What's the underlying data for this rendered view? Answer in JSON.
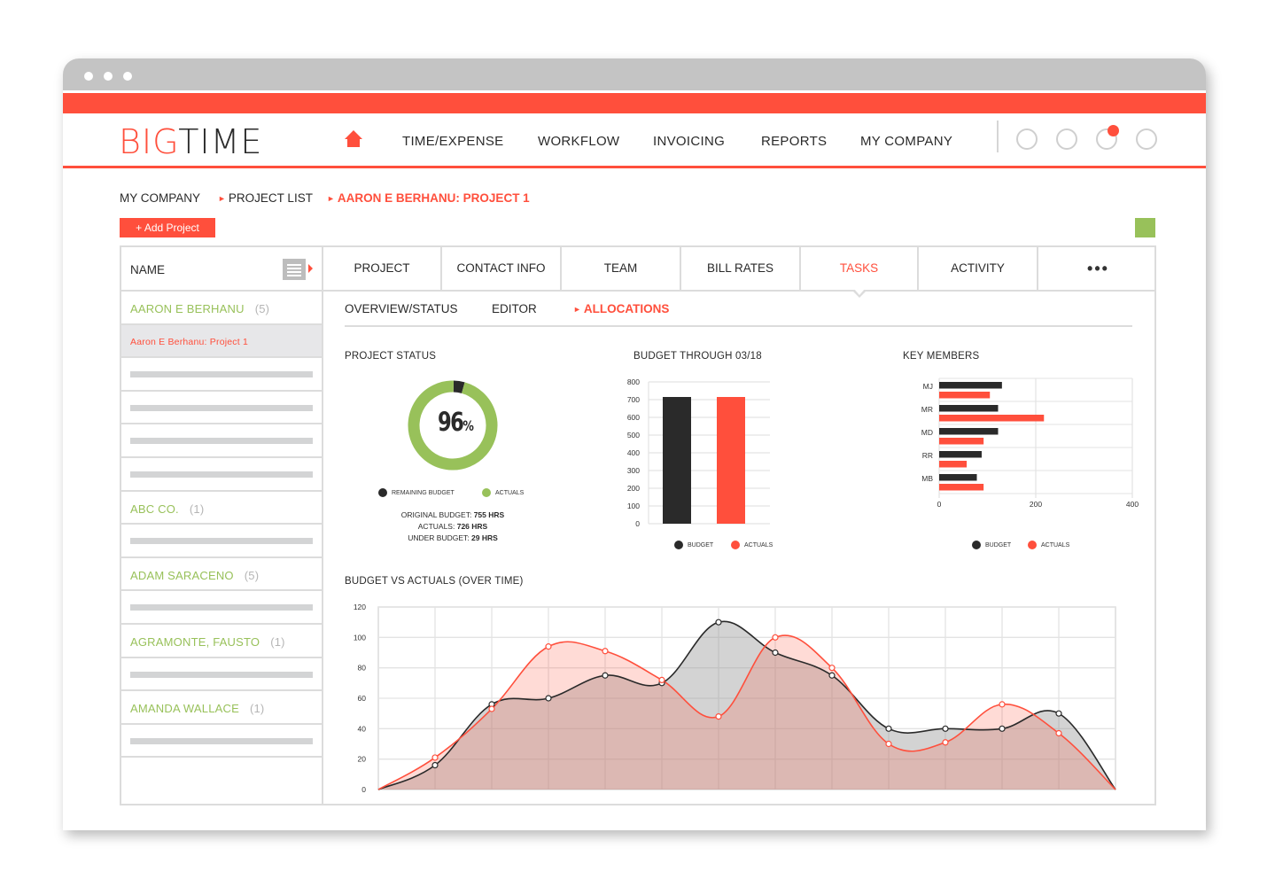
{
  "window": {
    "controls": [
      "close",
      "minimize",
      "maximize"
    ]
  },
  "header": {
    "logo_part1": "BIG",
    "logo_part2": "TIME",
    "home_icon": "home-icon",
    "nav": [
      "TIME/EXPENSE",
      "WORKFLOW",
      "INVOICING",
      "REPORTS",
      "MY COMPANY"
    ],
    "action_icons": [
      "action-icon-1",
      "action-icon-2",
      "notifications-icon",
      "action-icon-4"
    ],
    "notification_badge": true
  },
  "breadcrumb": [
    "MY COMPANY",
    "PROJECT LIST",
    "AARON E BERHANU: PROJECT 1"
  ],
  "add_project_label": "+ Add Project",
  "left_list": {
    "header": "NAME",
    "rows": [
      {
        "type": "group",
        "name": "AARON E BERHANU",
        "count": "(5)"
      },
      {
        "type": "selected",
        "name": "Aaron E Berhanu: Project 1"
      },
      {
        "type": "placeholder"
      },
      {
        "type": "placeholder"
      },
      {
        "type": "placeholder"
      },
      {
        "type": "placeholder"
      },
      {
        "type": "group",
        "name": "ABC CO.",
        "count": "(1)"
      },
      {
        "type": "placeholder"
      },
      {
        "type": "group",
        "name": "ADAM SARACENO",
        "count": "(5)"
      },
      {
        "type": "placeholder"
      },
      {
        "type": "group",
        "name": "AGRAMONTE, FAUSTO",
        "count": "(1)"
      },
      {
        "type": "placeholder"
      },
      {
        "type": "group",
        "name": "AMANDA WALLACE",
        "count": "(1)"
      },
      {
        "type": "placeholder"
      }
    ]
  },
  "tabs": [
    "PROJECT",
    "CONTACT INFO",
    "TEAM",
    "BILL RATES",
    "TASKS",
    "ACTIVITY",
    "•••"
  ],
  "active_tab": "TASKS",
  "subtabs": [
    "OVERVIEW/STATUS",
    "EDITOR",
    "ALLOCATIONS"
  ],
  "active_subtab": "ALLOCATIONS",
  "colors": {
    "accent": "#ff4f3c",
    "green": "#98c15a",
    "dark": "#2a2a2a",
    "grid": "#e3e3e3"
  },
  "project_status": {
    "title": "PROJECT STATUS",
    "percent_label": "96",
    "percent_sign": "%",
    "legend": [
      "REMAINING BUDGET",
      "ACTUALS"
    ],
    "stats": [
      {
        "label": "ORIGINAL BUDGET:",
        "value": "755 HRS"
      },
      {
        "label": "ACTUALS:",
        "value": "726 HRS"
      },
      {
        "label": "UNDER BUDGET:",
        "value": "29 HRS"
      }
    ]
  },
  "budget_through": {
    "title": "BUDGET THROUGH 03/18",
    "legend": [
      "BUDGET",
      "ACTUALS"
    ]
  },
  "key_members": {
    "title": "KEY MEMBERS",
    "legend": [
      "BUDGET",
      "ACTUALS"
    ]
  },
  "budget_vs_actuals": {
    "title": "BUDGET VS ACTUALS (OVER TIME)"
  },
  "chart_data": [
    {
      "type": "pie",
      "title": "PROJECT STATUS",
      "categories": [
        "REMAINING BUDGET",
        "ACTUALS"
      ],
      "values": [
        4,
        96
      ],
      "center_label": "96%"
    },
    {
      "type": "bar",
      "title": "BUDGET THROUGH 03/18",
      "categories": [
        "BUDGET",
        "ACTUALS"
      ],
      "values": [
        715,
        715
      ],
      "ylim": [
        0,
        800
      ],
      "yticks": [
        0,
        100,
        200,
        300,
        400,
        500,
        600,
        700,
        800
      ],
      "grid": true,
      "legend": "bottom"
    },
    {
      "type": "bar",
      "orientation": "horizontal",
      "title": "KEY MEMBERS",
      "categories": [
        "MJ",
        "MR",
        "MD",
        "RR",
        "MB"
      ],
      "series": [
        {
          "name": "BUDGET",
          "values": [
            130,
            122,
            122,
            88,
            78
          ]
        },
        {
          "name": "ACTUALS",
          "values": [
            105,
            217,
            92,
            57,
            92
          ]
        }
      ],
      "xlim": [
        0,
        400
      ],
      "xticks": [
        0,
        200,
        400
      ],
      "grid": true,
      "legend": "bottom"
    },
    {
      "type": "area",
      "title": "BUDGET VS ACTUALS (OVER TIME)",
      "x": [
        0,
        1,
        2,
        3,
        4,
        5,
        6,
        7,
        8,
        9,
        10,
        11,
        12,
        13
      ],
      "series": [
        {
          "name": "BUDGET",
          "values": [
            0,
            16,
            56,
            60,
            75,
            70,
            110,
            90,
            75,
            40,
            40,
            40,
            50,
            0
          ]
        },
        {
          "name": "ACTUALS",
          "values": [
            0,
            21,
            53,
            94,
            91,
            72,
            48,
            100,
            80,
            30,
            31,
            56,
            37,
            0
          ]
        }
      ],
      "ylim": [
        0,
        120
      ],
      "yticks": [
        0,
        20,
        40,
        60,
        80,
        100,
        120
      ],
      "grid": true
    }
  ]
}
